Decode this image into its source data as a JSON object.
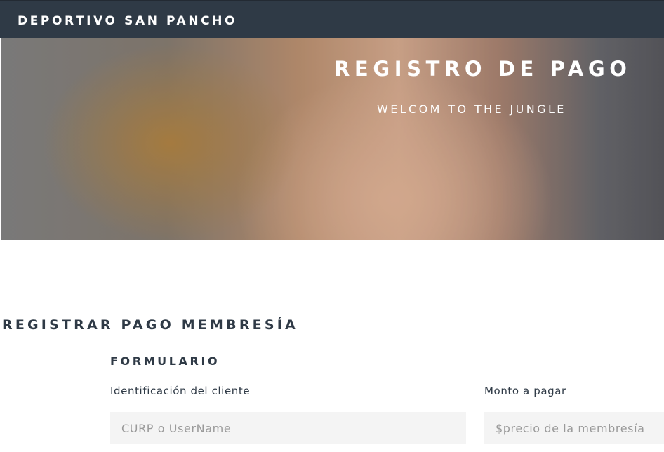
{
  "header": {
    "brand": "DEPORTIVO SAN PANCHO"
  },
  "hero": {
    "title": "REGISTRO DE PAGO",
    "subtitle": "WELCOM TO THE JUNGLE"
  },
  "section": {
    "title": "REGISTRAR PAGO MEMBRESÍA"
  },
  "form": {
    "title": "FORMULARIO",
    "client_label": "Identificación del cliente",
    "client_placeholder": "CURP o UserName",
    "amount_label": "Monto a pagar",
    "amount_placeholder": "$precio de la membresía"
  },
  "colors": {
    "header_bg": "#2f3a46",
    "text": "#2f3a46",
    "input_bg": "#f4f4f4"
  }
}
